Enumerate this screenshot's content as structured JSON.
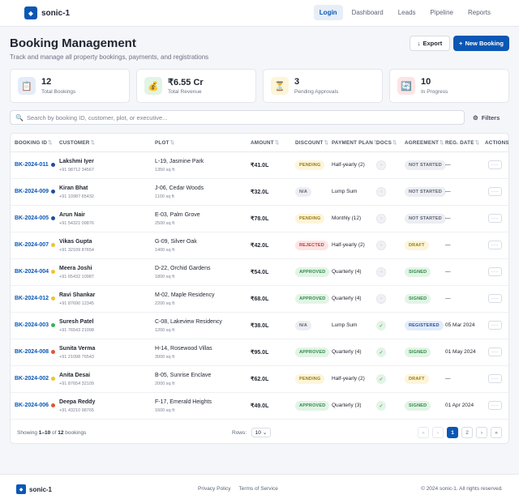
{
  "app": {
    "name": "sonic-1"
  },
  "nav": [
    {
      "label": "Login",
      "active": true
    },
    {
      "label": "Dashboard",
      "active": false
    },
    {
      "label": "Leads",
      "active": false
    },
    {
      "label": "Pipeline",
      "active": false
    },
    {
      "label": "Reports",
      "active": false
    }
  ],
  "header": {
    "title": "Booking Management",
    "subtitle": "Track and manage all property bookings, payments, and registrations",
    "export_label": "Export",
    "new_label": "New Booking"
  },
  "stats": [
    {
      "value": "12",
      "label": "Total Bookings",
      "icon": "clipboard-icon"
    },
    {
      "value": "₹6.55 Cr",
      "label": "Total Revenue",
      "icon": "money-bag-icon"
    },
    {
      "value": "3",
      "label": "Pending Approvals",
      "icon": "hourglass-icon"
    },
    {
      "value": "10",
      "label": "In Progress",
      "icon": "refresh-icon"
    }
  ],
  "search": {
    "placeholder": "Search by booking ID, customer, plot, or executive...",
    "value": ""
  },
  "filters_label": "Filters",
  "columns": [
    "BOOKING ID",
    "CUSTOMER",
    "PLOT",
    "AMOUNT",
    "DISCOUNT",
    "PAYMENT PLAN",
    "DOCS",
    "AGREEMENT",
    "REG. DATE",
    "ACTIONS"
  ],
  "rows": [
    {
      "id": "BK-2024-011",
      "dot": "#1e4fa0",
      "name": "Lakshmi Iyer",
      "phone": "+91 98712 34567",
      "plot": "L-19, Jasmine Park",
      "size": "1350 sq ft",
      "amount": "₹41.0L",
      "discount": "PENDING",
      "plan": "Half-yearly (2)",
      "docs": false,
      "agreement": "NOT STARTED",
      "date": "—"
    },
    {
      "id": "BK-2024-009",
      "dot": "#1e4fa0",
      "name": "Kiran Bhat",
      "phone": "+91 10987 65432",
      "plot": "J-06, Cedar Woods",
      "size": "1100 sq ft",
      "amount": "₹32.0L",
      "discount": "N/A",
      "plan": "Lump Sum",
      "docs": false,
      "agreement": "NOT STARTED",
      "date": "—"
    },
    {
      "id": "BK-2024-005",
      "dot": "#1e4fa0",
      "name": "Arun Nair",
      "phone": "+91 54321 09876",
      "plot": "E-03, Palm Grove",
      "size": "2500 sq ft",
      "amount": "₹78.0L",
      "discount": "PENDING",
      "plan": "Monthly (12)",
      "docs": false,
      "agreement": "NOT STARTED",
      "date": "—"
    },
    {
      "id": "BK-2024-007",
      "dot": "#f2c230",
      "name": "Vikas Gupta",
      "phone": "+91 32109 87654",
      "plot": "G-09, Silver Oak",
      "size": "1400 sq ft",
      "amount": "₹42.0L",
      "discount": "REJECTED",
      "plan": "Half-yearly (2)",
      "docs": false,
      "agreement": "DRAFT",
      "date": "—"
    },
    {
      "id": "BK-2024-004",
      "dot": "#f2c230",
      "name": "Meera Joshi",
      "phone": "+91 65432 10987",
      "plot": "D-22, Orchid Gardens",
      "size": "1800 sq ft",
      "amount": "₹54.0L",
      "discount": "APPROVED",
      "plan": "Quarterly (4)",
      "docs": false,
      "agreement": "SIGNED",
      "date": "—"
    },
    {
      "id": "BK-2024-012",
      "dot": "#f2c230",
      "name": "Ravi Shankar",
      "phone": "+91 87690 12345",
      "plot": "M-02, Maple Residency",
      "size": "2200 sq ft",
      "amount": "₹68.0L",
      "discount": "APPROVED",
      "plan": "Quarterly (4)",
      "docs": false,
      "agreement": "SIGNED",
      "date": "—"
    },
    {
      "id": "BK-2024-003",
      "dot": "#3fae5a",
      "name": "Suresh Patel",
      "phone": "+91 76543 21098",
      "plot": "C-08, Lakeview Residency",
      "size": "1200 sq ft",
      "amount": "₹38.0L",
      "discount": "N/A",
      "plan": "Lump Sum",
      "docs": true,
      "agreement": "REGISTERED",
      "date": "05 Mar 2024"
    },
    {
      "id": "BK-2024-008",
      "dot": "#e0553c",
      "name": "Sunita Verma",
      "phone": "+91 21098 76543",
      "plot": "H-14, Rosewood Villas",
      "size": "3000 sq ft",
      "amount": "₹95.0L",
      "discount": "APPROVED",
      "plan": "Quarterly (4)",
      "docs": true,
      "agreement": "SIGNED",
      "date": "01 May 2024"
    },
    {
      "id": "BK-2024-002",
      "dot": "#f2c230",
      "name": "Anita Desai",
      "phone": "+91 87654 32109",
      "plot": "B-05, Sunrise Enclave",
      "size": "2000 sq ft",
      "amount": "₹62.0L",
      "discount": "PENDING",
      "plan": "Half-yearly (2)",
      "docs": true,
      "agreement": "DRAFT",
      "date": "—"
    },
    {
      "id": "BK-2024-006",
      "dot": "#e0553c",
      "name": "Deepa Reddy",
      "phone": "+91 43210 98765",
      "plot": "F-17, Emerald Heights",
      "size": "1600 sq ft",
      "amount": "₹49.0L",
      "discount": "APPROVED",
      "plan": "Quarterly (3)",
      "docs": true,
      "agreement": "SIGNED",
      "date": "01 Apr 2024"
    }
  ],
  "pagination": {
    "showing_prefix": "Showing ",
    "showing_range": "1–10",
    "showing_of": " of ",
    "showing_total": "12",
    "showing_suffix": " bookings",
    "rows_label": "Rows:",
    "rows_value": "10",
    "pages": [
      "1",
      "2"
    ],
    "current": "1"
  },
  "footer": {
    "links": [
      "Privacy Policy",
      "Terms of Service"
    ],
    "copyright": "© 2024 sonic-1. All rights reserved."
  },
  "colors": {
    "primary": "#0b57b4",
    "pending_bg": "#fdf5d9",
    "pending_fg": "#9a7a12",
    "na_bg": "#eceef2",
    "na_fg": "#5c6475",
    "rejected_bg": "#fde4e4",
    "rejected_fg": "#c23a3a",
    "approved_bg": "#e2f4e6",
    "approved_fg": "#2e8a45",
    "registered_bg": "#e3ecfa",
    "registered_fg": "#2457a8"
  }
}
